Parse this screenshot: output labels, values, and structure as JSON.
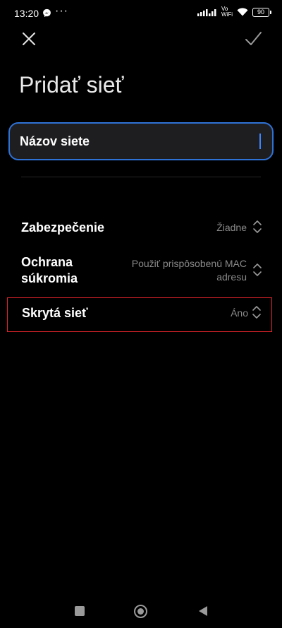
{
  "status_bar": {
    "time": "13:20",
    "volte_top": "Vo",
    "volte_bottom": "WiFi",
    "battery": "90",
    "icons": [
      "messenger-icon",
      "more-dots-icon",
      "signal-icon",
      "volte-wifi-icon",
      "wifi-icon",
      "battery-icon"
    ]
  },
  "header": {
    "close_icon": "close-icon",
    "confirm_icon": "check-icon"
  },
  "page": {
    "title": "Pridať sieť"
  },
  "network_name": {
    "placeholder": "Názov siete",
    "value": ""
  },
  "settings": {
    "security": {
      "label": "Zabezpečenie",
      "value": "Žiadne"
    },
    "privacy": {
      "label_line1": "Ochrana",
      "label_line2": "súkromia",
      "value_line1": "Použiť prispôsobenú MAC",
      "value_line2": "adresu"
    },
    "hidden": {
      "label": "Skrytá sieť",
      "value": "Áno"
    }
  },
  "colors": {
    "background": "#000000",
    "accent": "#2f72d6",
    "highlight_border": "#e0242b",
    "value_text": "#8a8a8a"
  },
  "nav_bar": {
    "icons": [
      "recents-icon",
      "home-icon",
      "back-icon"
    ]
  }
}
